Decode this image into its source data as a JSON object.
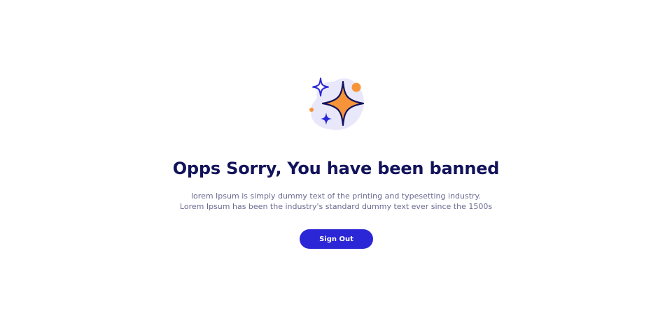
{
  "illustration": {
    "icon": "sparkles-icon",
    "colors": {
      "blob": "#e9e8fb",
      "big_star_fill": "#f7943a",
      "outline": "#13135c",
      "small_stars": "#2b27d6",
      "dots": "#f7943a"
    }
  },
  "main": {
    "title": "Opps Sorry, You have been banned",
    "description_lines": [
      "lorem Ipsum is simply dummy text of the printing and typesetting industry.",
      "Lorem Ipsum has been the industry's standard dummy text ever since the 1500s"
    ],
    "signout_label": "Sign Out"
  },
  "colors": {
    "title": "#13135c",
    "text": "#6a6a92",
    "accent": "#2b27d6",
    "background": "#ffffff"
  }
}
